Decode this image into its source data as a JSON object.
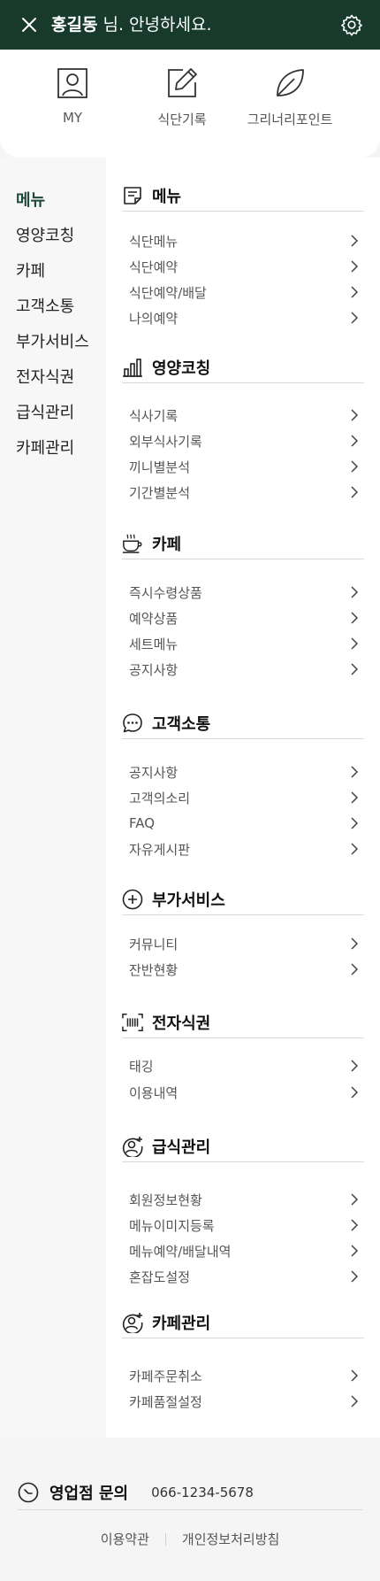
{
  "header": {
    "user_name": "홍길동",
    "greeting_suffix": " 님. 안녕하세요."
  },
  "quick_links": [
    {
      "label": "MY",
      "icon": "user-icon"
    },
    {
      "label": "식단기록",
      "icon": "edit-icon"
    },
    {
      "label": "그리너리포인트",
      "icon": "leaf-icon"
    }
  ],
  "side_nav": {
    "items": [
      "메뉴",
      "영양코칭",
      "카페",
      "고객소통",
      "부가서비스",
      "전자식권",
      "급식관리",
      "카페관리"
    ],
    "active": "메뉴"
  },
  "sections": [
    {
      "title": "메뉴",
      "icon": "document-icon",
      "items": [
        "식단메뉴",
        "식단예약",
        "식단예약/배달",
        "나의예약"
      ]
    },
    {
      "title": "영양코칭",
      "icon": "bar-chart-icon",
      "items": [
        "식사기록",
        "외부식사기록",
        "끼니별분석",
        "기간별분석"
      ]
    },
    {
      "title": "카페",
      "icon": "coffee-cup-icon",
      "items": [
        "즉시수령상품",
        "예약상품",
        "세트메뉴",
        "공지사항"
      ]
    },
    {
      "title": "고객소통",
      "icon": "chat-bubble-icon",
      "items": [
        "공지사항",
        "고객의소리",
        "FAQ",
        "자유게시판"
      ]
    },
    {
      "title": "부가서비스",
      "icon": "plus-circle-icon",
      "items": [
        "커뮤니티",
        "잔반현황"
      ]
    },
    {
      "title": "전자식권",
      "icon": "barcode-icon",
      "items": [
        "태깅",
        "이용내역"
      ]
    },
    {
      "title": "급식관리",
      "icon": "user-add-icon",
      "items": [
        "회원정보현황",
        "메뉴이미지등록",
        "메뉴예약/배달내역",
        "혼잡도설정"
      ]
    },
    {
      "title": "카페관리",
      "icon": "user-add-icon",
      "items": [
        "카페주문취소",
        "카페품절설정"
      ]
    }
  ],
  "footer": {
    "contact_title": "영업점 문의",
    "phone": "066-1234-5678",
    "links": [
      "이용약관",
      "개인정보처리방침"
    ]
  },
  "colors": {
    "header_bg": "#173a2c",
    "active_nav": "#1d4a38"
  }
}
